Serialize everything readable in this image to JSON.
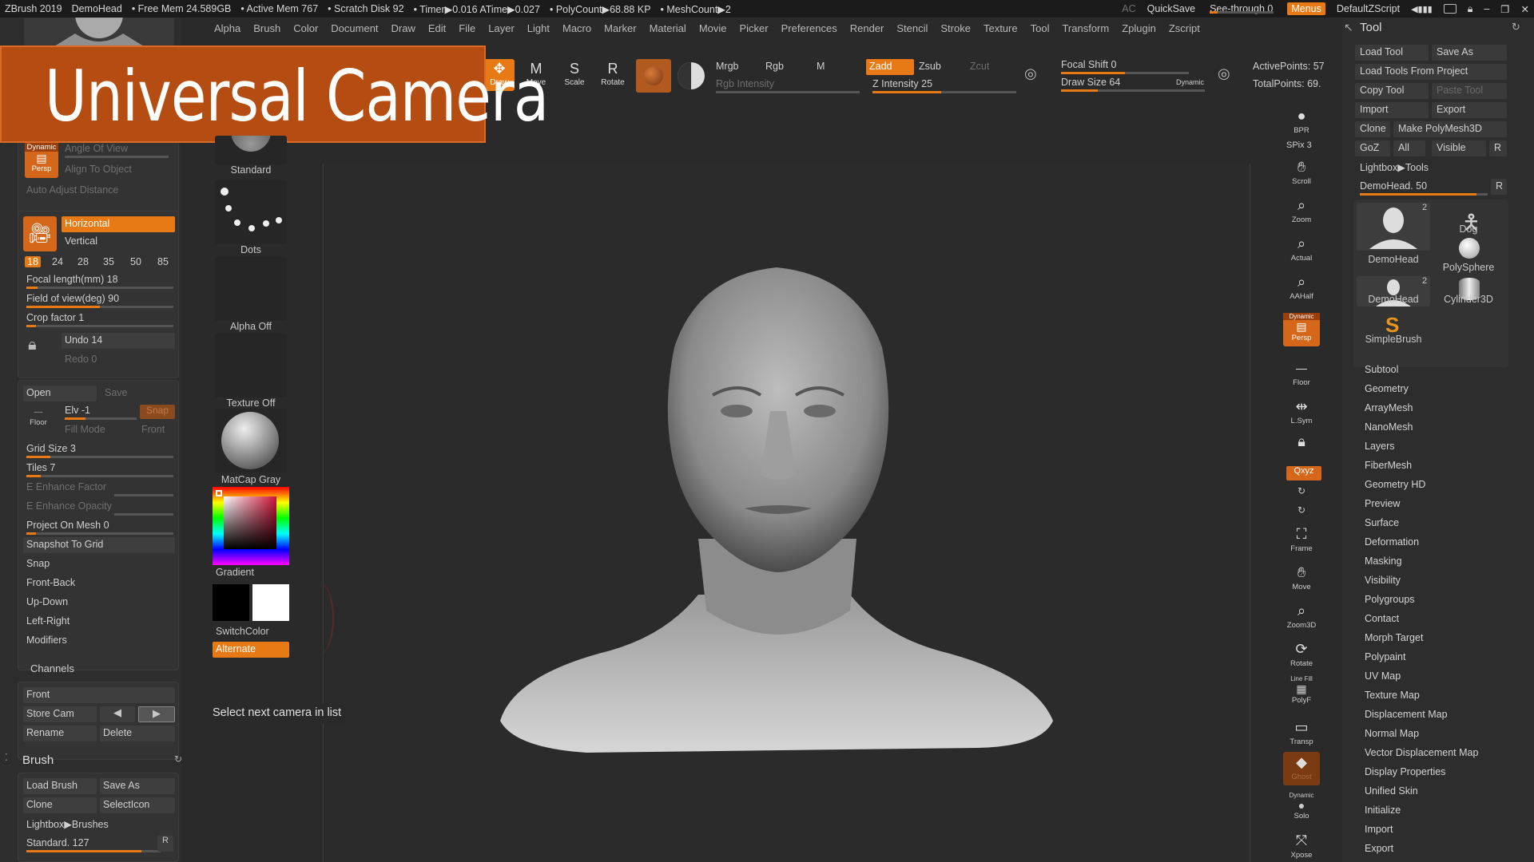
{
  "titlebar": {
    "app": "ZBrush 2019",
    "doc": "DemoHead",
    "free_mem": "• Free Mem 24.589GB",
    "active_mem": "• Active Mem 767",
    "scratch": "• Scratch Disk 92",
    "timer": "• Timer▶0.016 ATime▶0.027",
    "polycount": "• PolyCount▶68.88 KP",
    "meshcount": "• MeshCount▶2",
    "ac": "AC",
    "quicksave": "QuickSave",
    "seethrough": "See-through  0",
    "menus": "Menus",
    "script": "DefaultZScript"
  },
  "menubar": [
    "Alpha",
    "Brush",
    "Color",
    "Document",
    "Draw",
    "Edit",
    "File",
    "Layer",
    "Light",
    "Macro",
    "Marker",
    "Material",
    "Movie",
    "Picker",
    "Preferences",
    "Render",
    "Stencil",
    "Stroke",
    "Texture",
    "Tool",
    "Transform",
    "Zplugin",
    "Zscript"
  ],
  "banner": {
    "title": "Universal Camera"
  },
  "camera": {
    "persp_label": "Persp",
    "persp_dyn": "Dynamic",
    "angle_of_view": "Angle Of View",
    "align_to_object": "Align To Object",
    "auto_adjust": "Auto Adjust Distance",
    "horizontal": "Horizontal",
    "vertical": "Vertical",
    "focal_presets": [
      "18",
      "24",
      "28",
      "35",
      "50",
      "85"
    ],
    "focal_length": "Focal length(mm) 18",
    "fov": "Field of view(deg) 90",
    "crop": "Crop factor 1",
    "undo": "Undo 14",
    "redo": "Redo 0"
  },
  "floor": {
    "open": "Open",
    "save": "Save",
    "floor": "Floor",
    "elv": "Elv -1",
    "snap": "Snap",
    "fill_mode": "Fill Mode",
    "front": "Front",
    "grid_size": "Grid Size 3",
    "tiles": "Tiles 7",
    "e_enh_factor": "E Enhance Factor",
    "e_enh_opacity": "E Enhance Opacity",
    "project_on_mesh": "Project On Mesh 0",
    "snapshot": "Snapshot To Grid",
    "snap2": "Snap",
    "front_back": "Front-Back",
    "up_down": "Up-Down",
    "left_right": "Left-Right",
    "modifiers": "Modifiers"
  },
  "channels": {
    "title": "Channels",
    "front": "Front",
    "store_cam": "Store Cam",
    "rename": "Rename",
    "delete": "Delete"
  },
  "brush_panel": {
    "title": "Brush",
    "load": "Load Brush",
    "save_as": "Save As",
    "clone": "Clone",
    "select_icon": "SelectIcon",
    "lightbox": "Lightbox▶Brushes",
    "standard": "Standard. 127",
    "r": "R"
  },
  "materials": {
    "standard": "Standard",
    "dots": "Dots",
    "alpha_off": "Alpha Off",
    "texture_off": "Texture Off",
    "matcap": "MatCap Gray",
    "gradient": "Gradient",
    "switch_color": "SwitchColor",
    "alternate": "Alternate"
  },
  "toolbar": {
    "draw": "Draw",
    "move": "Move",
    "scale": "Scale",
    "rotate": "Rotate",
    "mrgb": "Mrgb",
    "rgb": "Rgb",
    "m": "M",
    "rgb_intensity": "Rgb Intensity",
    "zadd": "Zadd",
    "zsub": "Zsub",
    "zcut": "Zcut",
    "z_intensity": "Z Intensity 25",
    "focal_shift": "Focal Shift 0",
    "draw_size": "Draw Size 64",
    "dynamic": "Dynamic",
    "active_points": "ActivePoints: 57",
    "total_points": "TotalPoints: 69."
  },
  "tooltip": "Select next camera in list",
  "shelf": {
    "bpr": "BPR",
    "spix": "SPix 3",
    "scroll": "Scroll",
    "zoom": "Zoom",
    "actual": "Actual",
    "aahalf": "AAHalf",
    "persp": "Persp",
    "dynamic": "Dynamic",
    "floor": "Floor",
    "lsym": "L.Sym",
    "xyz": "Qxyz",
    "frame": "Frame",
    "move": "Move",
    "zoom3d": "Zoom3D",
    "rotate": "Rotate",
    "linefill": "Line Fill",
    "polyf": "PolyF",
    "transp": "Transp",
    "ghost": "Ghost",
    "solo": "Solo",
    "xpose": "Xpose"
  },
  "tool": {
    "title": "Tool",
    "load_tool": "Load Tool",
    "save_as": "Save As",
    "load_from_project": "Load Tools From Project",
    "copy_tool": "Copy Tool",
    "paste_tool": "Paste Tool",
    "import": "Import",
    "export": "Export",
    "clone": "Clone",
    "make_polymesh": "Make PolyMesh3D",
    "goz": "GoZ",
    "all": "All",
    "visible": "Visible",
    "r": "R",
    "lightbox": "Lightbox▶Tools",
    "demohead": "DemoHead. 50",
    "thumbs": [
      "DemoHead",
      "Dog",
      "PolySphere",
      "DemoHead",
      "Cylinder3D",
      "SimpleBrush"
    ],
    "count_2": "2",
    "sections": [
      "Subtool",
      "Geometry",
      "ArrayMesh",
      "NanoMesh",
      "Layers",
      "FiberMesh",
      "Geometry HD",
      "Preview",
      "Surface",
      "Deformation",
      "Masking",
      "Visibility",
      "Polygroups",
      "Contact",
      "Morph Target",
      "Polypaint",
      "UV Map",
      "Texture Map",
      "Displacement Map",
      "Normal Map",
      "Vector Displacement Map",
      "Display Properties",
      "Unified Skin",
      "Initialize",
      "Import",
      "Export"
    ]
  }
}
